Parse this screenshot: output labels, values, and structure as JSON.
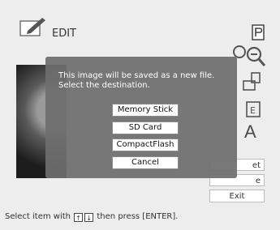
{
  "header": {
    "title": "EDIT",
    "edit_icon": "pencil-icon",
    "print_icon": "print-icon"
  },
  "tools": {
    "zoom_in_icon": "zoom-in-icon",
    "zoom_out_icon": "zoom-out-icon",
    "rotate_icon": "rotate-icon",
    "text_edit_icon": "text-edit-icon",
    "font_label": "A"
  },
  "side_buttons": {
    "item_1_label": "et",
    "item_2_label": "e",
    "exit_label": "Exit"
  },
  "dialog": {
    "message": "This image will be saved as a new file.\nSelect the destination.",
    "options": [
      "Memory Stick",
      "SD Card",
      "CompactFlash",
      "Cancel"
    ]
  },
  "status": {
    "prefix": "Select item with",
    "key_up": "↑",
    "key_down": "↓",
    "suffix": "then press [ENTER]."
  },
  "colors": {
    "background": "#ededed",
    "dialog_bg": "#6e6e6e",
    "button_bg": "#ffffff"
  }
}
